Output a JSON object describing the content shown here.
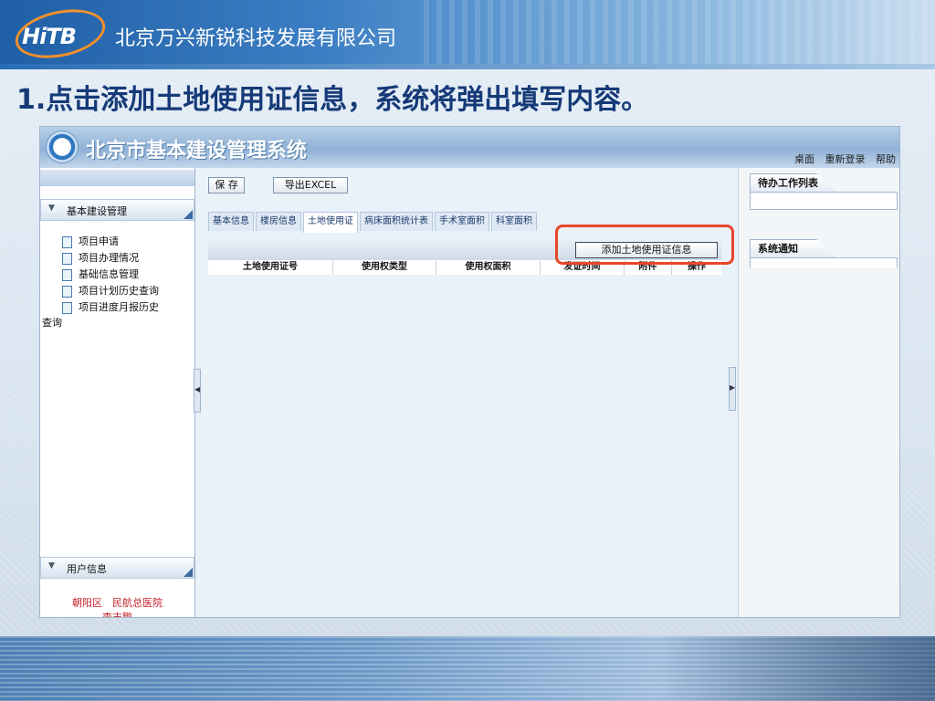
{
  "slide": {
    "company": "北京万兴新锐科技发展有限公司",
    "logo_text": "HiTB",
    "step_title": "1.点击添加土地使用证信息，系统将弹出填写内容。"
  },
  "app": {
    "title": "北京市基本建设管理系统",
    "header_links": [
      "桌面",
      "重新登录",
      "帮助"
    ]
  },
  "left_panel": {
    "section_main": "基本建设管理",
    "items": [
      "项目申请",
      "项目办理情况",
      "基础信息管理",
      "项目计划历史查询",
      "项目进度月报历史"
    ],
    "item_wrap": "查询",
    "section_user": "用户信息",
    "user_line1": "朝阳区　民航总医院",
    "user_line2": "李志鹏"
  },
  "center": {
    "save_label": "保 存",
    "export_label": "导出EXCEL",
    "tabs": [
      "基本信息",
      "楼房信息",
      "土地使用证",
      "病床面积统计表",
      "手术室面积",
      "科室面积"
    ],
    "active_tab": "土地使用证",
    "add_button_label": "添加土地使用证信息",
    "columns": [
      "土地使用证号",
      "使用权类型",
      "使用权面积",
      "发证时间",
      "附件",
      "操作"
    ]
  },
  "right_panel": {
    "todo_title": "待办工作列表",
    "notice_title": "系统通知"
  },
  "colors": {
    "highlight": "#e8462a",
    "title_blue": "#163a78",
    "user_red": "#c0202a"
  }
}
